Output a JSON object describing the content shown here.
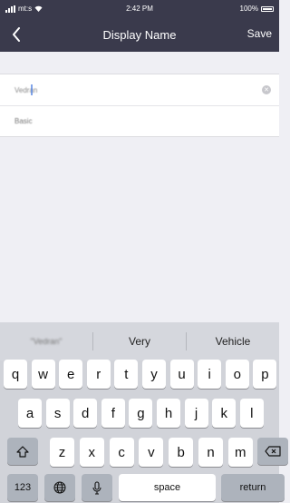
{
  "status_bar": {
    "carrier": "mt:s",
    "time": "2:42 PM",
    "battery": "100%"
  },
  "nav": {
    "title": "Display Name",
    "save_label": "Save"
  },
  "form": {
    "first_value": "Vedran",
    "second_placeholder": "Basic"
  },
  "keyboard": {
    "predictions": [
      "\"Vedran\"",
      "Very",
      "Vehicle"
    ],
    "row1": [
      "q",
      "w",
      "e",
      "r",
      "t",
      "y",
      "u",
      "i",
      "o",
      "p"
    ],
    "row2": [
      "a",
      "s",
      "d",
      "f",
      "g",
      "h",
      "j",
      "k",
      "l"
    ],
    "row3": [
      "z",
      "x",
      "c",
      "v",
      "b",
      "n",
      "m"
    ],
    "numbers_label": "123",
    "space_label": "space",
    "return_label": "return"
  }
}
